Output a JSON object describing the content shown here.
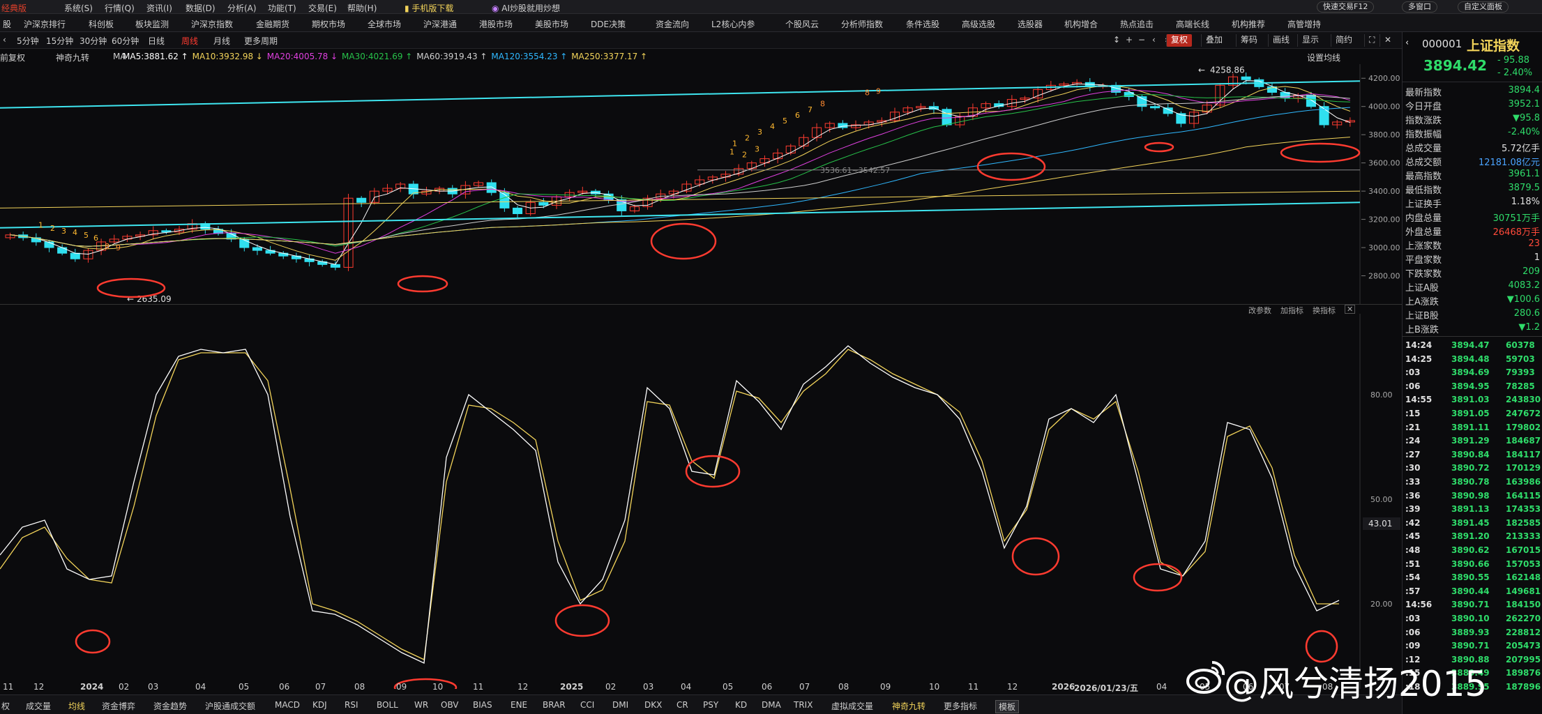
{
  "menubar": {
    "brand": "经典版",
    "items": [
      "系统(S)",
      "行情(Q)",
      "资讯(I)",
      "数据(D)",
      "分析(A)",
      "功能(T)",
      "交易(E)",
      "帮助(H)"
    ],
    "hot_items": [
      "手机版下载",
      "AI炒股就用炒想"
    ],
    "right_buttons": [
      "快速交易F12",
      "多窗口",
      "自定义面板"
    ]
  },
  "submenu": {
    "items": [
      "沪深京排行",
      "科创板",
      "板块监测",
      "沪深京指数",
      "金融期货",
      "期权市场",
      "全球市场",
      "沪深港通",
      "港股市场",
      "美股市场",
      "DDE决策",
      "资金流向",
      "L2核心内参",
      "个股风云",
      "分析师指数",
      "条件选股",
      "高级选股",
      "选股器",
      "机构增合",
      "热点追击",
      "高端长线",
      "机构推荐",
      "高管增持"
    ]
  },
  "periodbar": {
    "items": [
      "5分钟",
      "15分钟",
      "30分钟",
      "60分钟",
      "日线",
      "周线",
      "月线",
      "更多周期"
    ],
    "active": "周线",
    "tools": [
      "复权",
      "叠加",
      "筹码",
      "画线",
      "显示",
      "简约"
    ]
  },
  "mabar": {
    "prefix": "神奇九转",
    "ma_prefix": "MA",
    "mode": "前复权",
    "items": [
      {
        "label": "MA5:3881.62",
        "color": "#ffffff"
      },
      {
        "label": "MA10:3932.98",
        "color": "#f3d45a"
      },
      {
        "label": "MA20:4005.78",
        "color": "#e040e0"
      },
      {
        "label": "MA30:4021.69",
        "color": "#27c24a"
      },
      {
        "label": "MA60:3919.43",
        "color": "#cfcfcf"
      },
      {
        "label": "MA120:3554.23",
        "color": "#2fb8ff"
      },
      {
        "label": "MA250:3377.17",
        "color": "#f3d45a"
      }
    ],
    "settings": "设置均线"
  },
  "kchart": {
    "y_ticks": [
      4200,
      4000,
      3800,
      3600,
      3400,
      3200,
      3000,
      2800
    ],
    "y_labels": [
      "4200.00",
      "4000.00",
      "3800.00",
      "3600.00",
      "3400.00",
      "3200.00",
      "3000.00",
      "2800.00"
    ],
    "high_label": "4258.86",
    "low_label": "2635.09",
    "mid_label": "3536.61~3542.57"
  },
  "kdj": {
    "y_labels": [
      "80.00",
      "50.00",
      "20.00"
    ],
    "current": "43.01",
    "tools": [
      "改参数",
      "加指标",
      "换指标"
    ]
  },
  "chart_data": {
    "type": "candlestick",
    "title": "",
    "x_labels": [
      "11",
      "12",
      "2024",
      "02",
      "03",
      "04",
      "05",
      "06",
      "07",
      "08",
      "09",
      "10",
      "11",
      "12",
      "2025",
      "02",
      "03",
      "04",
      "05",
      "06",
      "07",
      "08",
      "09",
      "10",
      "11",
      "12",
      "2026",
      "2026/01/23/五",
      "04",
      "05",
      "06",
      "07",
      "08"
    ],
    "ylim": [
      2600,
      4300
    ],
    "close": [
      3090,
      3070,
      3040,
      3000,
      2960,
      2920,
      2980,
      3040,
      3060,
      3080,
      3090,
      3120,
      3110,
      3130,
      3170,
      3130,
      3100,
      3060,
      3000,
      2980,
      2960,
      2940,
      2920,
      2900,
      2880,
      2860,
      3350,
      3320,
      3400,
      3420,
      3450,
      3380,
      3400,
      3420,
      3380,
      3440,
      3460,
      3390,
      3280,
      3240,
      3320,
      3300,
      3360,
      3390,
      3400,
      3380,
      3340,
      3260,
      3290,
      3350,
      3380,
      3400,
      3450,
      3480,
      3500,
      3520,
      3560,
      3600,
      3630,
      3670,
      3720,
      3780,
      3850,
      3880,
      3850,
      3870,
      3890,
      3900,
      3960,
      3990,
      4000,
      3980,
      3870,
      3930,
      3990,
      4020,
      4000,
      4050,
      4060,
      4120,
      4150,
      4160,
      4170,
      4140,
      4150,
      4100,
      4070,
      4000,
      3990,
      3950,
      3880,
      3960,
      4010,
      4150,
      4210,
      4190,
      4140,
      4100,
      4060,
      4080,
      4000,
      3870,
      3890,
      3900
    ],
    "kdj_k": [
      34,
      42,
      44,
      30,
      27,
      28,
      55,
      80,
      91,
      93,
      92,
      93,
      80,
      45,
      18,
      17,
      14,
      10,
      6,
      3,
      62,
      80,
      75,
      70,
      64,
      32,
      20,
      27,
      44,
      82,
      76,
      58,
      57,
      84,
      78,
      70,
      83,
      88,
      94,
      89,
      85,
      82,
      80,
      73,
      58,
      36,
      48,
      73,
      76,
      72,
      80,
      55,
      30,
      28,
      38,
      72,
      70,
      56,
      31,
      18,
      21
    ],
    "kdj_d": [
      30,
      39,
      42,
      33,
      27,
      26,
      48,
      74,
      90,
      92,
      92,
      92,
      84,
      53,
      20,
      18,
      15,
      11,
      7,
      4,
      55,
      77,
      76,
      72,
      67,
      38,
      21,
      24,
      38,
      78,
      77,
      61,
      56,
      81,
      79,
      72,
      81,
      86,
      93,
      90,
      86,
      83,
      80,
      75,
      61,
      38,
      47,
      70,
      76,
      73,
      78,
      58,
      32,
      28,
      35,
      68,
      71,
      59,
      34,
      20,
      20
    ]
  },
  "xaxis_labels": [
    "11",
    "12",
    "2024",
    "02",
    "03",
    "04",
    "05",
    "06",
    "07",
    "08",
    "09",
    "10",
    "11",
    "12",
    "2025",
    "02",
    "03",
    "04",
    "05",
    "06",
    "07",
    "08",
    "09",
    "10",
    "11",
    "12",
    "2026",
    "2026/01/23/五",
    "04",
    "05",
    "06",
    "07",
    "08"
  ],
  "indbar": {
    "items": [
      "权",
      "成交量",
      "均线",
      "资金博弈",
      "资金趋势",
      "沪股通成交额",
      "MACD",
      "KDJ",
      "RSI",
      "BOLL",
      "WR",
      "OBV",
      "BIAS",
      "ENE",
      "BRAR",
      "CCI",
      "DMI",
      "DKX",
      "CR",
      "PSY",
      "KD",
      "DMA",
      "TRIX",
      "虚拟成交量",
      "神奇九转",
      "更多指标",
      "模板"
    ],
    "active": [
      "均线",
      "神奇九转"
    ]
  },
  "rightpanel": {
    "code": "000001",
    "name": "上证指数",
    "price": "3894.42",
    "change": "- 95.88",
    "change_pct": "- 2.40%",
    "stats": [
      {
        "label": "最新指数",
        "value": "3894.4",
        "color": "#2fdc6a"
      },
      {
        "label": "今日开盘",
        "value": "3952.1",
        "color": "#2fdc6a"
      },
      {
        "label": "指数涨跌",
        "value": "▼95.8",
        "color": "#2fdc6a"
      },
      {
        "label": "指数振幅",
        "value": "-2.40%",
        "color": "#2fdc6a"
      },
      {
        "label": "总成交量",
        "value": "5.72亿手",
        "color": "#e0e0e0"
      },
      {
        "label": "总成交额",
        "value": "12181.08亿元",
        "color": "#4aa3ff"
      },
      {
        "label": "最高指数",
        "value": "3961.1",
        "color": "#2fdc6a"
      },
      {
        "label": "最低指数",
        "value": "3879.5",
        "color": "#2fdc6a"
      },
      {
        "label": "上证换手",
        "value": "1.18%",
        "color": "#e0e0e0"
      },
      {
        "label": "内盘总量",
        "value": "30751万手",
        "color": "#2fdc6a"
      },
      {
        "label": "外盘总量",
        "value": "26468万手",
        "color": "#ff4a3a"
      },
      {
        "label": "上涨家数",
        "value": "23",
        "color": "#ff4a3a"
      },
      {
        "label": "平盘家数",
        "value": "1",
        "color": "#e0e0e0"
      },
      {
        "label": "下跌家数",
        "value": "209",
        "color": "#2fdc6a"
      },
      {
        "label": "上证A股",
        "value": "4083.2",
        "color": "#2fdc6a"
      },
      {
        "label": "上A涨跌",
        "value": "▼100.6",
        "color": "#2fdc6a"
      },
      {
        "label": "上证B股",
        "value": "280.6",
        "color": "#2fdc6a"
      },
      {
        "label": "上B涨跌",
        "value": "▼1.2",
        "color": "#2fdc6a"
      }
    ],
    "ticks": [
      {
        "time": "14:24",
        "price": "3894.47",
        "vol": "60378"
      },
      {
        "time": "14:25",
        "price": "3894.48",
        "vol": "59703"
      },
      {
        "time": ":03",
        "price": "3894.69",
        "vol": "79393"
      },
      {
        "time": ":06",
        "price": "3894.95",
        "vol": "78285"
      },
      {
        "time": "14:55",
        "price": "3891.03",
        "vol": "243830"
      },
      {
        "time": ":15",
        "price": "3891.05",
        "vol": "247672"
      },
      {
        "time": ":21",
        "price": "3891.11",
        "vol": "179802"
      },
      {
        "time": ":24",
        "price": "3891.29",
        "vol": "184687"
      },
      {
        "time": ":27",
        "price": "3890.84",
        "vol": "184117"
      },
      {
        "time": ":30",
        "price": "3890.72",
        "vol": "170129"
      },
      {
        "time": ":33",
        "price": "3890.78",
        "vol": "163986"
      },
      {
        "time": ":36",
        "price": "3890.98",
        "vol": "164115"
      },
      {
        "time": ":39",
        "price": "3891.13",
        "vol": "174353"
      },
      {
        "time": ":42",
        "price": "3891.45",
        "vol": "182585"
      },
      {
        "time": ":45",
        "price": "3891.20",
        "vol": "213333"
      },
      {
        "time": ":48",
        "price": "3890.62",
        "vol": "167015"
      },
      {
        "time": ":51",
        "price": "3890.66",
        "vol": "157053"
      },
      {
        "time": ":54",
        "price": "3890.55",
        "vol": "162148"
      },
      {
        "time": ":57",
        "price": "3890.44",
        "vol": "149681"
      },
      {
        "time": "14:56",
        "price": "3890.71",
        "vol": "184150"
      },
      {
        "time": ":03",
        "price": "3890.10",
        "vol": "262270"
      },
      {
        "time": ":06",
        "price": "3889.93",
        "vol": "228812"
      },
      {
        "time": ":09",
        "price": "3890.71",
        "vol": "205473"
      },
      {
        "time": ":12",
        "price": "3890.88",
        "vol": "207995"
      },
      {
        "time": ":15",
        "price": "3889.49",
        "vol": "189876"
      },
      {
        "time": ":18",
        "price": "3889.95",
        "vol": "187896"
      }
    ]
  },
  "watermark": "@风兮清扬2015",
  "colors": {
    "up": "#ff3b30",
    "down": "#30e0f0",
    "cyan_line": "#3fe6f0",
    "circle": "#ff3b30"
  }
}
